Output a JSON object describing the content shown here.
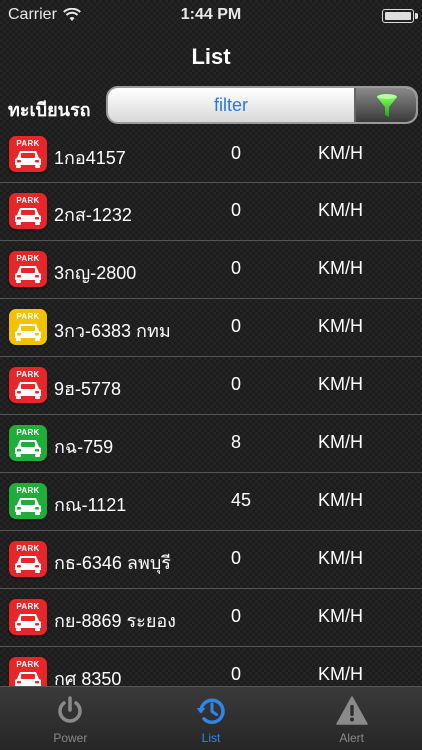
{
  "status_bar": {
    "carrier": "Carrier",
    "time": "1:44 PM"
  },
  "nav": {
    "title": "List"
  },
  "filter": {
    "label": "ทะเบียนรถ",
    "placeholder": "filter"
  },
  "list": {
    "items": [
      {
        "badge": "PARK",
        "status": "red",
        "plate": "1กอ4157",
        "speed": "0",
        "unit": "KM/H"
      },
      {
        "badge": "PARK",
        "status": "red",
        "plate": "2กส-1232",
        "speed": "0",
        "unit": "KM/H"
      },
      {
        "badge": "PARK",
        "status": "red",
        "plate": "3กญ-2800",
        "speed": "0",
        "unit": "KM/H"
      },
      {
        "badge": "PARK",
        "status": "yellow",
        "plate": "3กว-6383 กทม",
        "speed": "0",
        "unit": "KM/H"
      },
      {
        "badge": "PARK",
        "status": "red",
        "plate": "9ฮ-5778",
        "speed": "0",
        "unit": "KM/H"
      },
      {
        "badge": "PARK",
        "status": "green",
        "plate": "กฉ-759",
        "speed": "8",
        "unit": "KM/H"
      },
      {
        "badge": "PARK",
        "status": "green",
        "plate": "กณ-1121",
        "speed": "45",
        "unit": "KM/H"
      },
      {
        "badge": "PARK",
        "status": "red",
        "plate": "กธ-6346 ลพบุรี",
        "speed": "0",
        "unit": "KM/H"
      },
      {
        "badge": "PARK",
        "status": "red",
        "plate": "กย-8869 ระยอง",
        "speed": "0",
        "unit": "KM/H"
      },
      {
        "badge": "PARK",
        "status": "red",
        "plate": "กศ 8350",
        "speed": "0",
        "unit": "KM/H"
      }
    ]
  },
  "status_colors": {
    "red": "#e8262a",
    "yellow": "#f2c200",
    "green": "#1fae3a"
  },
  "tab_bar": {
    "tabs": [
      {
        "label": "Power",
        "icon": "power-icon"
      },
      {
        "label": "List",
        "icon": "history-clock-icon"
      },
      {
        "label": "Alert",
        "icon": "warning-icon"
      }
    ],
    "active_color": "#2f86e8"
  }
}
